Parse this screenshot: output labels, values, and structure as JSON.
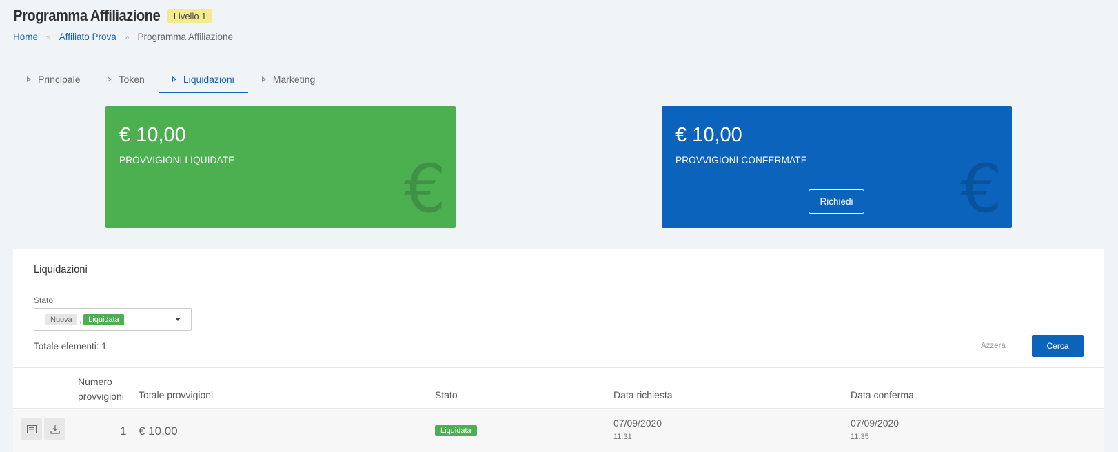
{
  "header": {
    "title": "Programma Affiliazione",
    "level_badge": "Livello 1",
    "breadcrumb": [
      {
        "label": "Home"
      },
      {
        "label": "Affiliato Prova"
      },
      {
        "label": "Programma Affiliazione"
      }
    ],
    "breadcrumb_separator": "»"
  },
  "tabs": [
    {
      "label": "Principale",
      "active": false
    },
    {
      "label": "Token",
      "active": false
    },
    {
      "label": "Liquidazioni",
      "active": true
    },
    {
      "label": "Marketing",
      "active": false
    }
  ],
  "cards": {
    "liquidated": {
      "amount": "€ 10,00",
      "label": "PROVVIGIONI LIQUIDATE",
      "color": "#4caf50",
      "icon": "euro-icon"
    },
    "confirmed": {
      "amount": "€ 10,00",
      "label": "PROVVIGIONI CONFERMATE",
      "color": "#0b63bc",
      "icon": "euro-icon",
      "button_label": "Richiedi"
    }
  },
  "panel": {
    "title": "Liquidazioni",
    "filter": {
      "label": "Stato",
      "selected": [
        {
          "label": "Nuova",
          "color": "#e6e6e6"
        },
        {
          "label": "Liquidata",
          "color": "#4caf50"
        }
      ],
      "separator": ","
    },
    "total_label": "Totale elementi: 1",
    "reset_label": "Azzera",
    "search_label": "Cerca"
  },
  "table": {
    "columns": {
      "count_line1": "Numero",
      "count_line2": "provvigioni",
      "total": "Totale provvigioni",
      "status": "Stato",
      "requested": "Data richiesta",
      "confirmed": "Data conferma"
    },
    "rows": [
      {
        "count": "1",
        "total": "€ 10,00",
        "status": "Liquidata",
        "requested_date": "07/09/2020",
        "requested_time": "11:31",
        "confirmed_date": "07/09/2020",
        "confirmed_time": "11:35",
        "actions": [
          "list-icon",
          "download-icon"
        ]
      }
    ]
  },
  "colors": {
    "accent": "#1a61b5",
    "success": "#4caf50",
    "primary_button": "#0b63bc",
    "level_badge": "#f4ea8e"
  }
}
